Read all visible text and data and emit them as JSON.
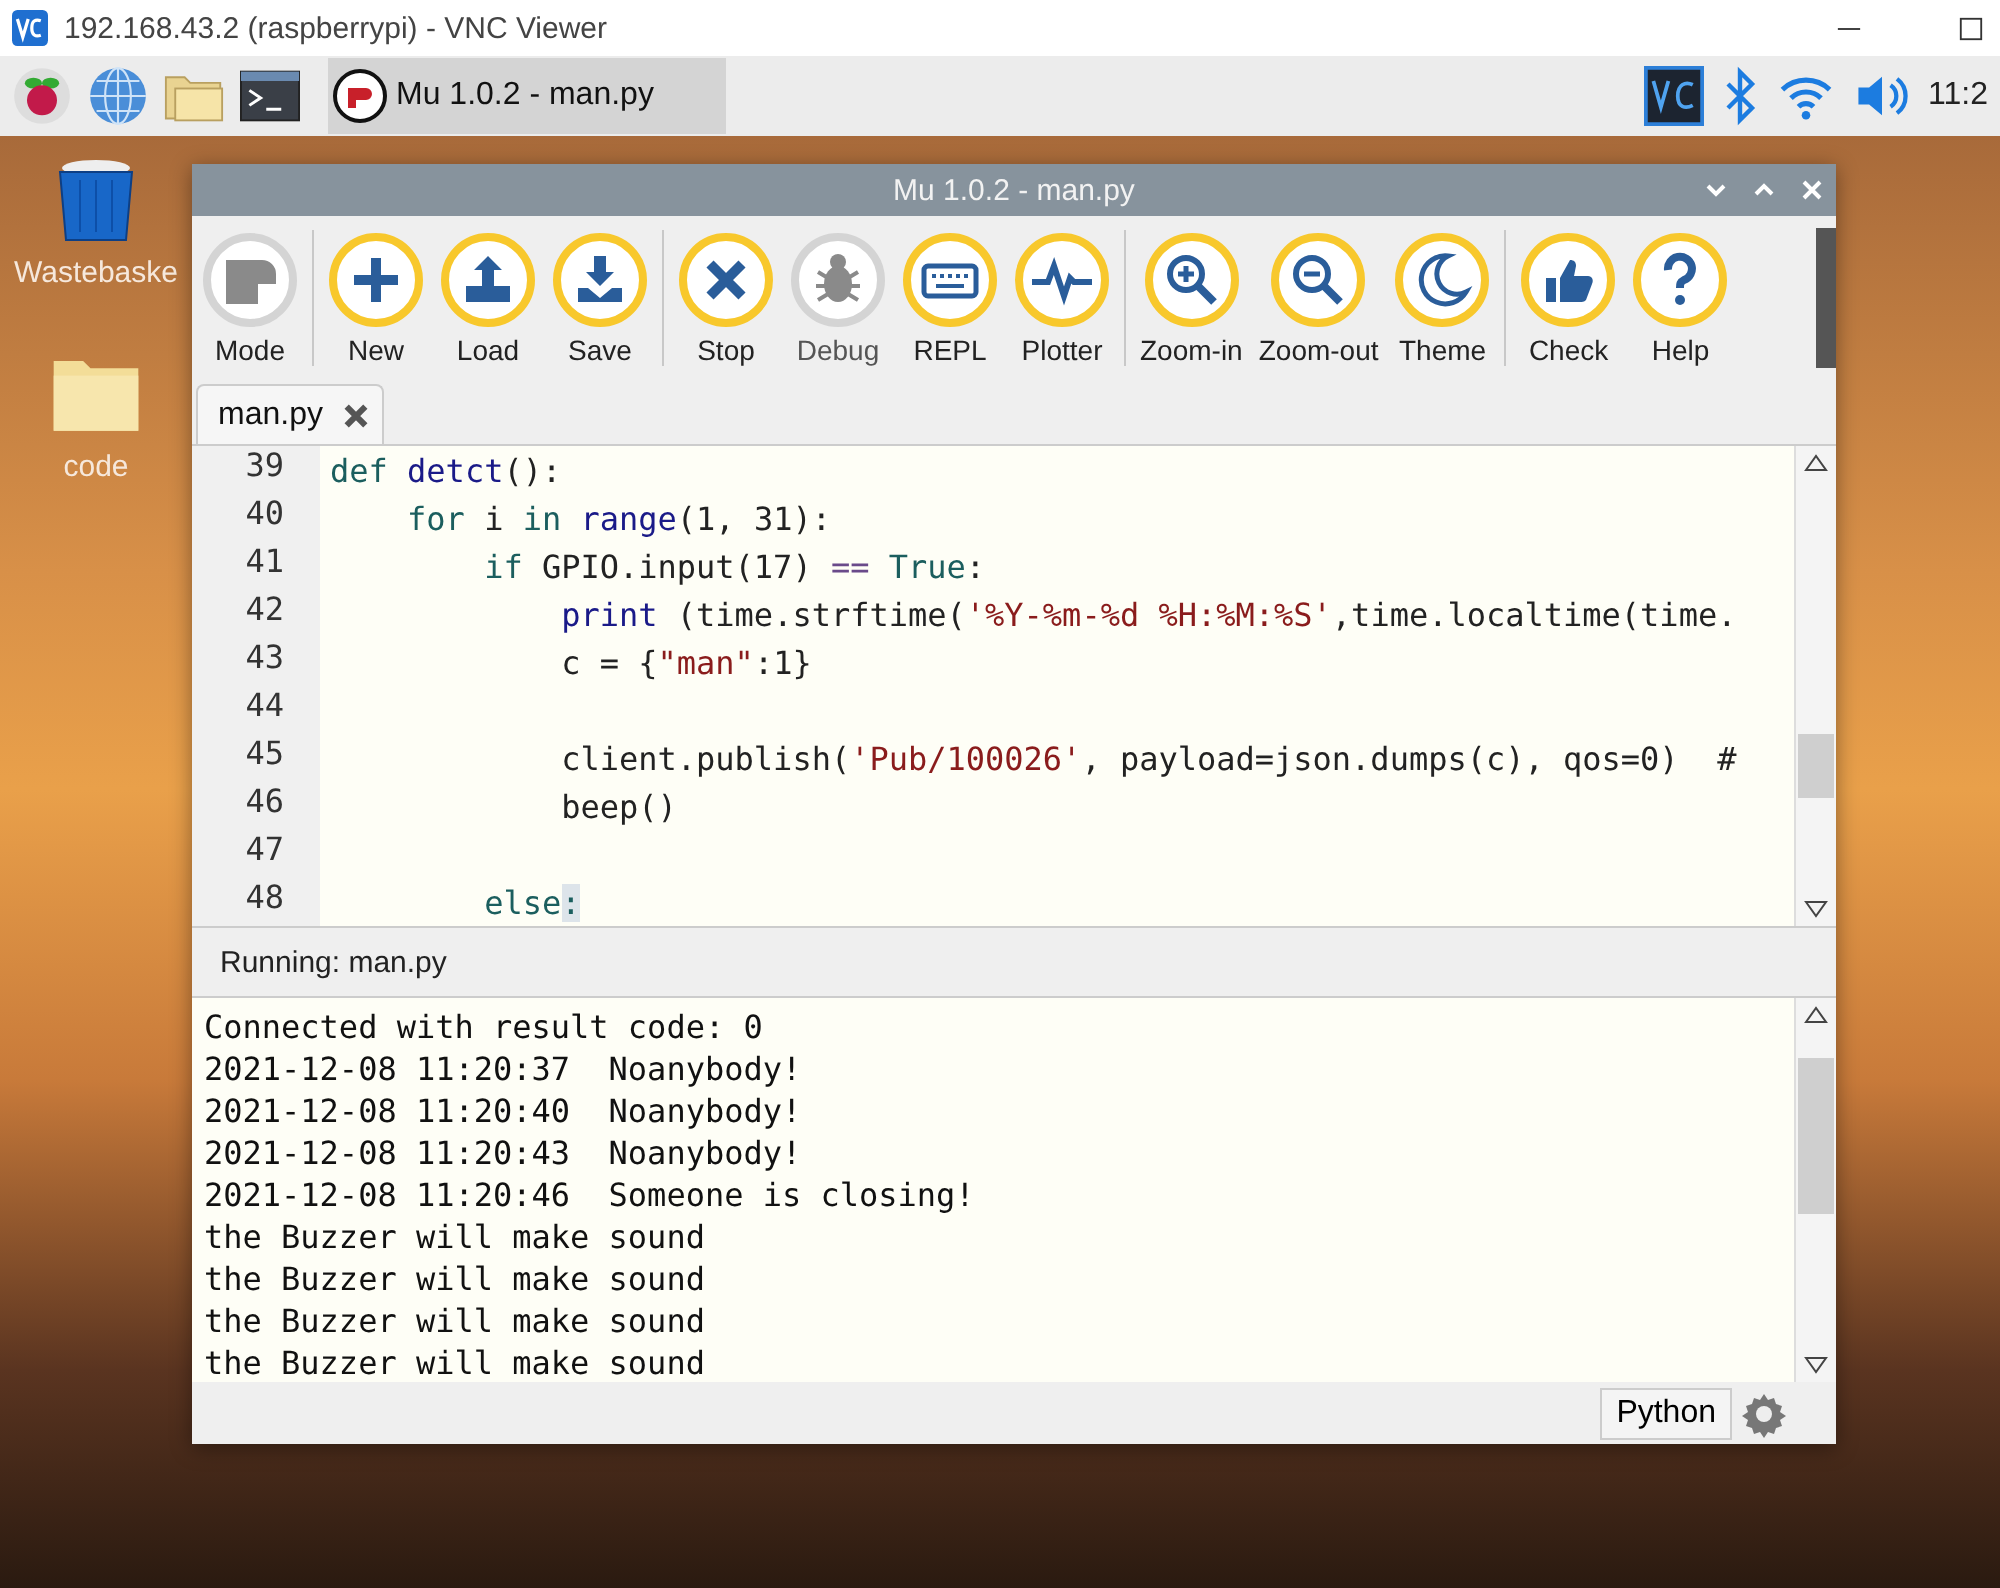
{
  "viewer": {
    "title": "192.168.43.2 (raspberrypi) - VNC Viewer"
  },
  "taskbar": {
    "launchers": [
      {
        "kind": "raspberry"
      },
      {
        "kind": "globe"
      },
      {
        "kind": "folder"
      },
      {
        "kind": "terminal"
      }
    ],
    "tasks": [
      {
        "label": "Mu 1.0.2 - man.py",
        "selected": true
      }
    ],
    "clock": "11:2"
  },
  "desktop": {
    "icons": [
      {
        "kind": "trash",
        "label": "Wastebaske"
      },
      {
        "kind": "folder",
        "label": "code"
      }
    ]
  },
  "window": {
    "title": "Mu 1.0.2 - man.py",
    "toolbar": [
      [
        {
          "label": "Mode",
          "kind": "mode",
          "disabled": false
        }
      ],
      [
        {
          "label": "New",
          "kind": "plus",
          "disabled": false
        },
        {
          "label": "Load",
          "kind": "upload",
          "disabled": false
        },
        {
          "label": "Save",
          "kind": "download",
          "disabled": false
        }
      ],
      [
        {
          "label": "Stop",
          "kind": "cross",
          "disabled": false
        },
        {
          "label": "Debug",
          "kind": "bug",
          "disabled": true
        },
        {
          "label": "REPL",
          "kind": "keyboard",
          "disabled": false
        },
        {
          "label": "Plotter",
          "kind": "pulse",
          "disabled": false
        }
      ],
      [
        {
          "label": "Zoom-in",
          "kind": "zoomin",
          "disabled": false
        },
        {
          "label": "Zoom-out",
          "kind": "zoomout",
          "disabled": false
        },
        {
          "label": "Theme",
          "kind": "moon",
          "disabled": false
        }
      ],
      [
        {
          "label": "Check",
          "kind": "thumb",
          "disabled": false
        },
        {
          "label": "Help",
          "kind": "question",
          "disabled": false
        }
      ]
    ],
    "tabs": [
      {
        "label": "man.py",
        "selected": true
      }
    ],
    "editor": {
      "lines": [
        {
          "number": "39",
          "tokens": [
            {
              "kind": "kw",
              "text": "def"
            },
            {
              "kind": "fn",
              "text": " detct"
            },
            {
              "kind": "plain",
              "text": "():"
            }
          ]
        },
        {
          "number": "40",
          "tokens": [
            {
              "kind": "kw",
              "text": "    for"
            },
            {
              "kind": "plain",
              "text": " i "
            },
            {
              "kind": "kw",
              "text": "in"
            },
            {
              "kind": "fn",
              "text": " range"
            },
            {
              "kind": "plain",
              "text": "(1, 31):"
            }
          ]
        },
        {
          "number": "41",
          "tokens": [
            {
              "kind": "kw",
              "text": "        if"
            },
            {
              "kind": "plain",
              "text": " GPIO.input(17) "
            },
            {
              "kind": "op",
              "text": "=="
            },
            {
              "kind": "kw",
              "text": " True"
            },
            {
              "kind": "plain",
              "text": ":"
            }
          ]
        },
        {
          "number": "42",
          "tokens": [
            {
              "kind": "fn",
              "text": "            print"
            },
            {
              "kind": "plain",
              "text": " (time.strftime("
            },
            {
              "kind": "str",
              "text": "'%Y-%m-%d %H:%M:%S'"
            },
            {
              "kind": "plain",
              "text": ",time.localtime(time."
            }
          ]
        },
        {
          "number": "43",
          "tokens": [
            {
              "kind": "plain",
              "text": "            c = {"
            },
            {
              "kind": "str",
              "text": "\"man\""
            },
            {
              "kind": "plain",
              "text": ":1}"
            }
          ]
        },
        {
          "number": "44"
        },
        {
          "number": "45",
          "tokens": [
            {
              "kind": "plain",
              "text": "            client.publish("
            },
            {
              "kind": "str",
              "text": "'Pub/100026'"
            },
            {
              "kind": "plain",
              "text": ", payload=json.dumps(c), qos=0)  #"
            }
          ]
        },
        {
          "number": "46",
          "tokens": [
            {
              "kind": "plain",
              "text": "            beep()"
            }
          ]
        },
        {
          "number": "47"
        },
        {
          "number": "48",
          "tokens": [
            {
              "kind": "kw",
              "text": "        else"
            },
            {
              "kind": "hl",
              "text": ":"
            }
          ]
        }
      ]
    },
    "runner": {
      "title": "Running: man.py",
      "output": [
        "Connected with result code: 0",
        "2021-12-08 11:20:37  Noanybody!",
        "2021-12-08 11:20:40  Noanybody!",
        "2021-12-08 11:20:43  Noanybody!",
        "2021-12-08 11:20:46  Someone is closing!",
        "the Buzzer will make sound",
        "the Buzzer will make sound",
        "the Buzzer will make sound",
        "the Buzzer will make sound"
      ]
    },
    "status_bar": {
      "mode": "Python"
    }
  }
}
